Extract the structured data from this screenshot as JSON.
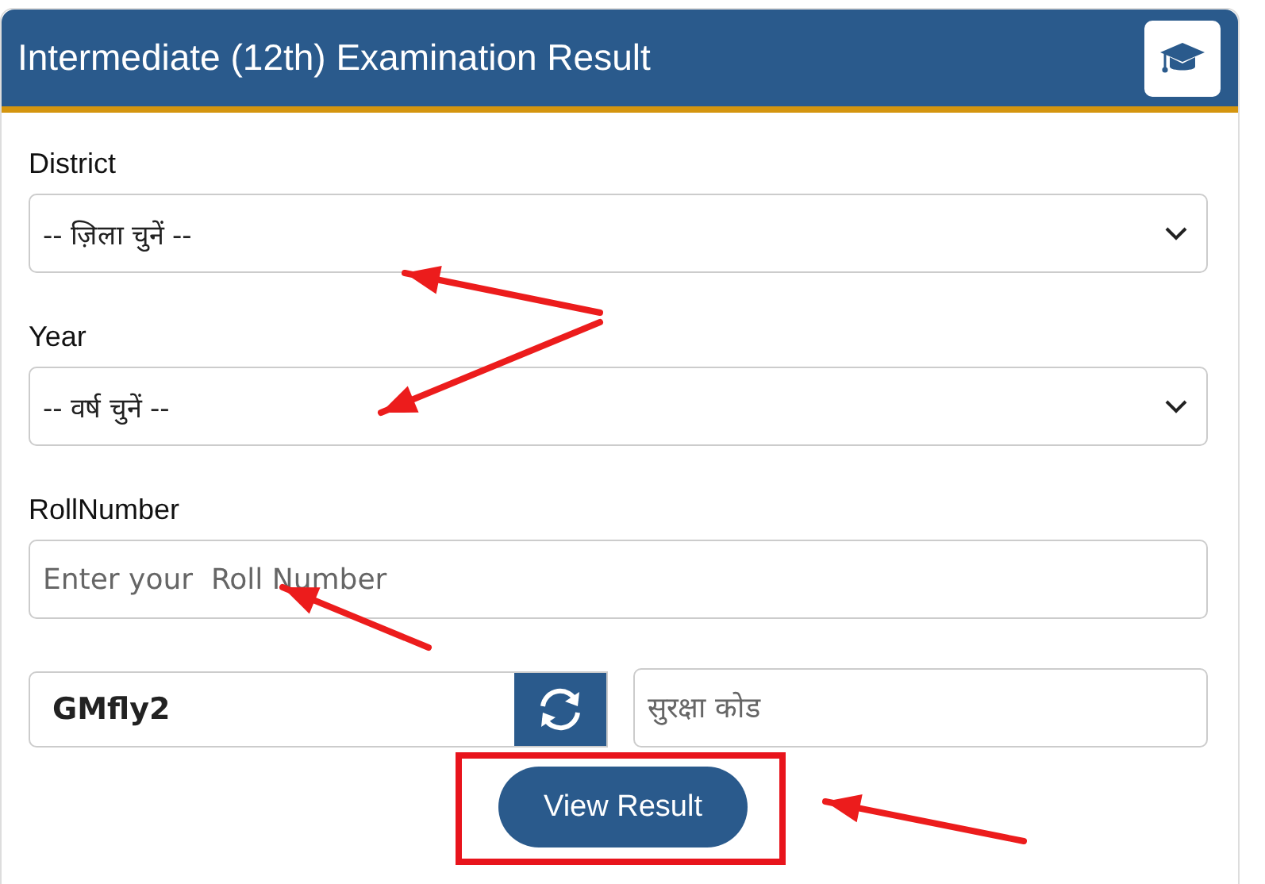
{
  "header": {
    "title": "Intermediate (12th) Examination Result"
  },
  "fields": [
    {
      "kind": "select",
      "label": "District",
      "value": "-- ज़िला चुनें --"
    },
    {
      "kind": "select",
      "label": "Year",
      "value": "-- वर्ष चुनें --"
    },
    {
      "kind": "input",
      "label": "RollNumber",
      "placeholder": "Enter your  Roll Number"
    }
  ],
  "captcha": {
    "code": "GMfly2",
    "placeholder": "सुरक्षा कोड"
  },
  "submit": {
    "label": "View Result"
  }
}
